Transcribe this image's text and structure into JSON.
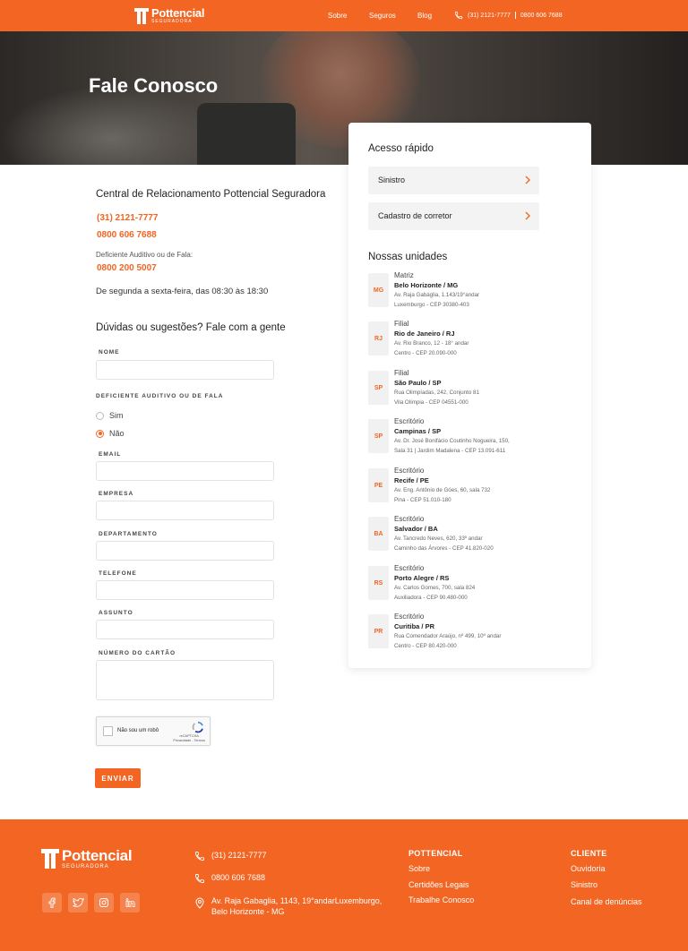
{
  "header": {
    "logo_main": "Pottencial",
    "logo_sub": "SEGURADORA",
    "nav": [
      "Sobre",
      "Seguros",
      "Blog"
    ],
    "phone1": "(31) 2121-7777",
    "phone2": "0800 606 7688"
  },
  "hero": {
    "title": "Fale Conosco"
  },
  "contact": {
    "title": "Central de Relacionamento Pottencial Seguradora",
    "phone1": "(31) 2121-7777",
    "phone2": "0800 606 7688",
    "deaf_label": "Deficiente Auditivo ou de Fala:",
    "deaf_phone": "0800 200 5007",
    "hours": "De segunda a sexta-feira, das 08:30 às 18:30"
  },
  "form": {
    "title": "Dúvidas ou sugestões? Fale com a gente",
    "labels": {
      "nome": "NOME",
      "deficiente": "DEFICIENTE AUDITIVO OU DE FALA",
      "email": "EMAIL",
      "empresa": "EMPRESA",
      "departamento": "DEPARTAMENTO",
      "telefone": "TELEFONE",
      "assunto": "ASSUNTO",
      "cartao": "NÚMERO DO CARTÃO"
    },
    "radio_options": [
      "Sim",
      "Não"
    ],
    "radio_selected": "Não",
    "captcha_label": "Não sou um robô",
    "captcha_brand": "reCAPTCHA",
    "captcha_terms": "Privacidade - Termos",
    "submit": "ENVIAR"
  },
  "sidebar": {
    "quick_title": "Acesso rápido",
    "quick_links": [
      "Sinistro",
      "Cadastro de corretor"
    ],
    "units_title": "Nossas unidades",
    "units": [
      {
        "badge": "MG",
        "type": "Matriz",
        "city": "Belo Horizonte / MG",
        "line1": "Av. Raja Gabáglia, 1.143/19°andar",
        "line2": "Luxemburgo - CEP 30380-403"
      },
      {
        "badge": "RJ",
        "type": "Filial",
        "city": "Rio de Janeiro / RJ",
        "line1": "Av. Rio Branco, 12 - 18° andar",
        "line2": "Centro - CEP 20.090-000"
      },
      {
        "badge": "SP",
        "type": "Filial",
        "city": "São Paulo / SP",
        "line1": "Rua Olimpíadas, 242, Conjunto 81",
        "line2": "Vila Olímpia - CEP 04551-000"
      },
      {
        "badge": "SP",
        "type": "Escritório",
        "city": "Campinas / SP",
        "line1": "Av. Dr. José Bonifácio Coutinho Nogueira, 150,",
        "line2": "Sala 31 | Jardim Madalena - CEP 13.091-611"
      },
      {
        "badge": "PE",
        "type": "Escritório",
        "city": "Recife / PE",
        "line1": "Av. Eng. Antônio de Góes, 60, sala 732",
        "line2": "Pina - CEP 51.010-180"
      },
      {
        "badge": "BA",
        "type": "Escritório",
        "city": "Salvador / BA",
        "line1": "Av. Tancredo Neves, 620, 33º andar",
        "line2": "Caminho das Árvores - CEP 41.820-020"
      },
      {
        "badge": "RS",
        "type": "Escritório",
        "city": "Porto Alegre / RS",
        "line1": "Av. Carlos Gomes, 700, sala 824",
        "line2": "Auxiliadora - CEP 90.480-000"
      },
      {
        "badge": "PR",
        "type": "Escritório",
        "city": "Curitiba / PR",
        "line1": "Rua Comendador Araújo, nº 499, 10º andar",
        "line2": "Centro - CEP 80.420-000"
      }
    ]
  },
  "footer": {
    "logo_main": "Pottencial",
    "logo_sub": "SEGURADORA",
    "phone1": "(31) 2121-7777",
    "phone2": "0800 606 7688",
    "address1": "Av. Raja Gabaglia, 1143, 19°andarLuxemburgo,",
    "address2": "Belo Horizonte - MG",
    "col1_title": "POTTENCIAL",
    "col1_links": [
      "Sobre",
      "Certidões Legais",
      "Trabalhe Conosco"
    ],
    "col2_title": "CLIENTE",
    "col2_links": [
      "Ouvidoria",
      "Sinistro",
      "Canal de denúncias"
    ],
    "social_icons": [
      "facebook-icon",
      "twitter-icon",
      "instagram-icon",
      "linkedin-icon"
    ]
  },
  "colors": {
    "brand": "#f26522"
  }
}
